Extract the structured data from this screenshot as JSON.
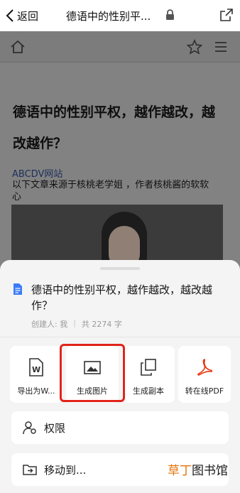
{
  "topbar": {
    "back_label": "返回",
    "title": "德语中的性别平..."
  },
  "article": {
    "title": "德语中的性别平权，越作越改，越改越作？",
    "site": "ABCDV网站",
    "source": "以下文章来源于核桃老学姐 ，作者核桃酱的软软心"
  },
  "sheet": {
    "doc_title": "德语中的性别平权，越作越改，越改越作？",
    "creator": "创建人: 我",
    "word_count": "共 2274 字",
    "actions": [
      {
        "label": "导出为W...",
        "icon": "word-file-icon"
      },
      {
        "label": "生成图片",
        "icon": "image-icon"
      },
      {
        "label": "生成副本",
        "icon": "copy-icon"
      },
      {
        "label": "转在线PDF",
        "icon": "pdf-icon"
      }
    ],
    "rows": [
      {
        "label": "权限",
        "icon": "user-settings-icon"
      },
      {
        "label": "移动到...",
        "icon": "folder-move-icon"
      }
    ]
  },
  "watermark": {
    "part1": "草丁",
    "part2": "图书馆"
  },
  "colors": {
    "highlight": "#e2231a",
    "doc_icon": "#3b7cf7",
    "pdf_icon": "#e8340c",
    "watermark_accent": "#e8740c"
  }
}
